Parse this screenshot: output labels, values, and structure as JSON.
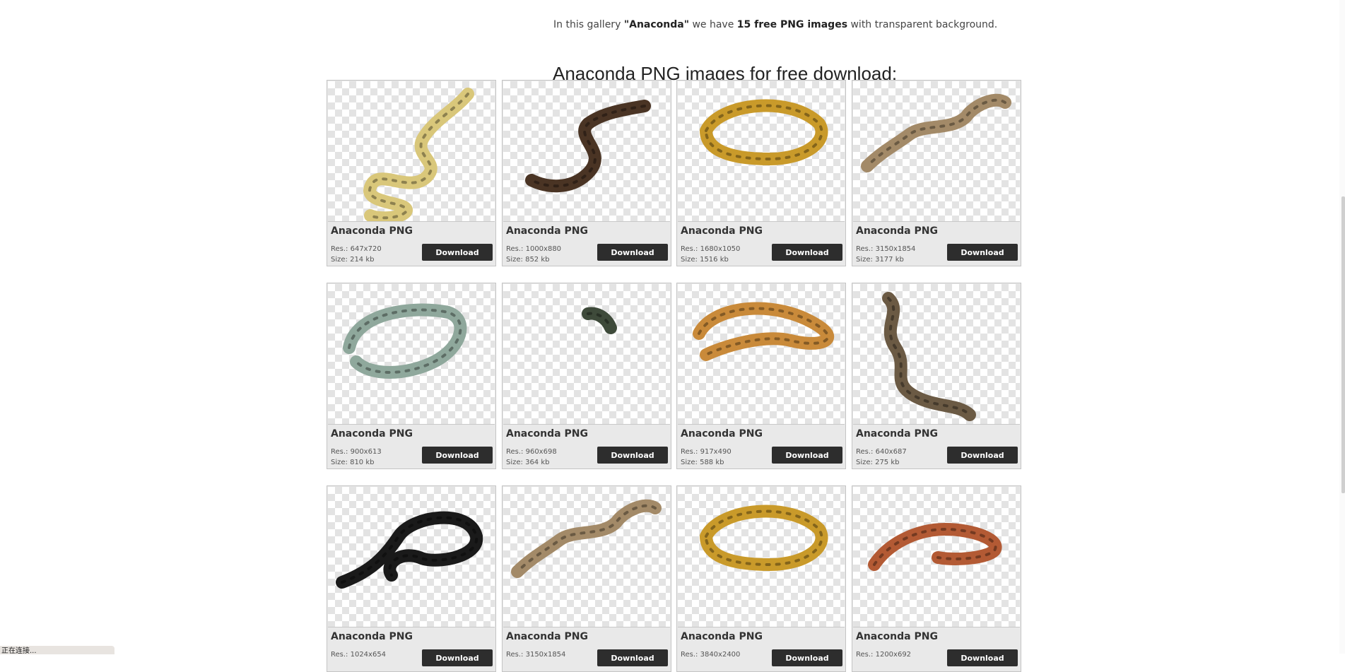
{
  "intro": {
    "prefix": "In this gallery ",
    "gallery_name": "\"Anaconda\"",
    "middle": " we have ",
    "count_text": "15 free PNG images",
    "suffix": " with transparent background."
  },
  "gallery_title": "Anaconda PNG images for free download:",
  "download_label": "Download",
  "cards": [
    {
      "title": "Anaconda PNG",
      "res": "Res.: 647x720",
      "size": "Size: 214 kb",
      "image": "yellow-anaconda-coiled",
      "color": "#d9c77a"
    },
    {
      "title": "Anaconda PNG",
      "res": "Res.: 1000x880",
      "size": "Size: 852 kb",
      "image": "brown-python-raised",
      "color": "#4a3424"
    },
    {
      "title": "Anaconda PNG",
      "res": "Res.: 1680x1050",
      "size": "Size: 1516 kb",
      "image": "yellow-black-python-coil",
      "color": "#c99a2a"
    },
    {
      "title": "Anaconda PNG",
      "res": "Res.: 3150x1854",
      "size": "Size: 3177 kb",
      "image": "tan-snake-stretched",
      "color": "#a38a68"
    },
    {
      "title": "Anaconda PNG",
      "res": "Res.: 900x613",
      "size": "Size: 810 kb",
      "image": "green-anaconda-coiled",
      "color": "#8fa89c"
    },
    {
      "title": "Anaconda PNG",
      "res": "Res.: 960x698",
      "size": "Size: 364 kb",
      "image": "small-snake-head",
      "color": "#3e4a3a"
    },
    {
      "title": "Anaconda PNG",
      "res": "Res.: 917x490",
      "size": "Size: 588 kb",
      "image": "orange-boa-coiled",
      "color": "#c98a3a"
    },
    {
      "title": "Anaconda PNG",
      "res": "Res.: 640x687",
      "size": "Size: 275 kb",
      "image": "brown-snake-slithering",
      "color": "#6b5a44"
    },
    {
      "title": "Anaconda PNG",
      "res": "Res.: 1024x654",
      "size": "",
      "image": "black-snake-coiled",
      "color": "#1a1a1a"
    },
    {
      "title": "Anaconda PNG",
      "res": "Res.: 3150x1854",
      "size": "",
      "image": "tan-snake-stretched",
      "color": "#a38a68"
    },
    {
      "title": "Anaconda PNG",
      "res": "Res.: 3840x2400",
      "size": "",
      "image": "yellow-black-python-coil",
      "color": "#c99a2a"
    },
    {
      "title": "Anaconda PNG",
      "res": "Res.: 1200x692",
      "size": "",
      "image": "red-boa-coiled",
      "color": "#b35a34"
    }
  ],
  "status_text": "正在连接..."
}
